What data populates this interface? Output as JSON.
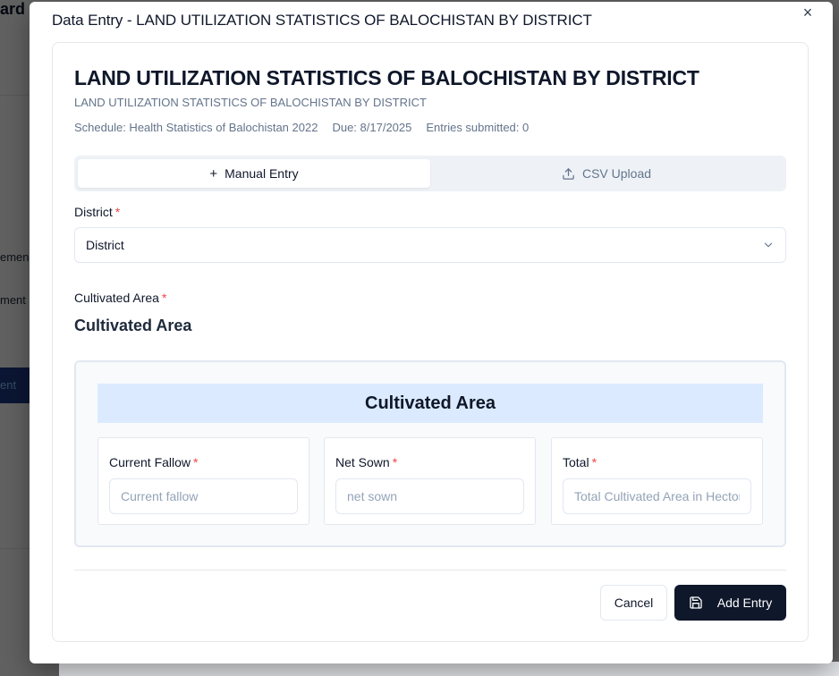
{
  "background": {
    "title_fragment": "ard",
    "nav_fragments": [
      "emen",
      "ment"
    ],
    "active_fragment": "ent"
  },
  "dialog": {
    "title": "Data Entry - LAND UTILIZATION STATISTICS OF BALOCHISTAN BY DISTRICT",
    "close_glyph": "×"
  },
  "form": {
    "title": "LAND UTILIZATION STATISTICS OF BALOCHISTAN BY DISTRICT",
    "subtitle": "LAND UTILIZATION STATISTICS OF BALOCHISTAN BY DISTRICT",
    "schedule": "Schedule: Health Statistics of Balochistan 2022",
    "due": "Due: 8/17/2025",
    "entries": "Entries submitted: 0"
  },
  "tabs": {
    "manual": {
      "label": "Manual Entry",
      "icon": "plus-icon"
    },
    "csv": {
      "label": "CSV Upload",
      "icon": "upload-icon"
    }
  },
  "district": {
    "label": "District",
    "required": "*",
    "value": "District"
  },
  "cultivated": {
    "label": "Cultivated Area",
    "required": "*",
    "section_title": "Cultivated Area",
    "group_header": "Cultivated Area",
    "fields": [
      {
        "label": "Current Fallow",
        "required": "*",
        "placeholder": "Current fallow"
      },
      {
        "label": "Net Sown",
        "required": "*",
        "placeholder": "net sown"
      },
      {
        "label": "Total",
        "required": "*",
        "placeholder": "Total Cultivated Area in Hectors"
      }
    ]
  },
  "footer": {
    "cancel_label": "Cancel",
    "add_label": "Add Entry"
  },
  "colors": {
    "primary": "#0f172a",
    "required": "#ef4444",
    "group_header_bg": "#dbeafe"
  }
}
